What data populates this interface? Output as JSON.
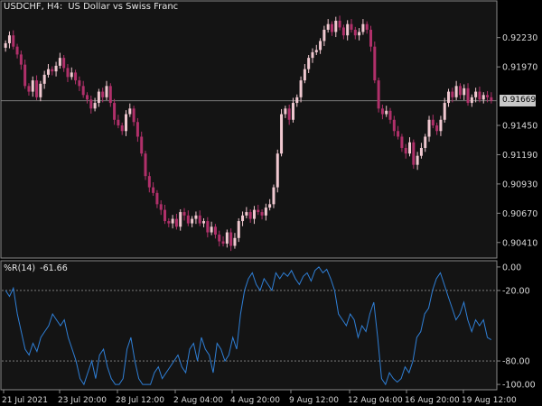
{
  "header": {
    "symbol": "USDCHF, H4:",
    "description": "US Dollar vs Swiss Franc"
  },
  "indicator": {
    "name": "%R(14)",
    "value": "-61.66"
  },
  "current_price": "0.91669",
  "colors": {
    "background": "#000000",
    "chart_bg": "#141414",
    "grid_border": "#8a8a8a",
    "bull_candle": "#f0c8d0",
    "bear_candle": "#b0306a",
    "indicator_line": "#2f7fd6",
    "level_line": "#8a8a8a"
  },
  "chart_data": [
    {
      "type": "candlestick",
      "title": "USDCHF, H4: US Dollar vs Swiss Franc",
      "y_ticks": [
        "0.92230",
        "0.91970",
        "0.91450",
        "0.91190",
        "0.90930",
        "0.90670",
        "0.90410"
      ],
      "ylim": [
        0.9032,
        0.925
      ],
      "x_ticks": [
        "21 Jul 2021",
        "23 Jul 20:00",
        "28 Jul 12:00",
        "2 Aug 04:00",
        "4 Aug 20:00",
        "9 Aug 12:00",
        "12 Aug 04:00",
        "16 Aug 20:00",
        "19 Aug 12:00"
      ],
      "current_price": 0.91669,
      "closes": [
        0.9218,
        0.9225,
        0.9215,
        0.9208,
        0.9199,
        0.918,
        0.9175,
        0.9185,
        0.917,
        0.9182,
        0.919,
        0.9195,
        0.9193,
        0.9198,
        0.9205,
        0.9196,
        0.9188,
        0.9192,
        0.9185,
        0.918,
        0.9172,
        0.9168,
        0.916,
        0.9165,
        0.9175,
        0.917,
        0.918,
        0.9165,
        0.915,
        0.9145,
        0.914,
        0.9155,
        0.916,
        0.9148,
        0.9135,
        0.912,
        0.91,
        0.909,
        0.9085,
        0.9075,
        0.907,
        0.906,
        0.9058,
        0.9062,
        0.9055,
        0.9068,
        0.9065,
        0.9058,
        0.9062,
        0.9065,
        0.9058,
        0.906,
        0.905,
        0.9055,
        0.9048,
        0.9042,
        0.904,
        0.905,
        0.9038,
        0.9045,
        0.906,
        0.9065,
        0.9068,
        0.9062,
        0.907,
        0.9068,
        0.9065,
        0.9072,
        0.9075,
        0.909,
        0.912,
        0.9155,
        0.916,
        0.915,
        0.9165,
        0.917,
        0.9185,
        0.9195,
        0.9205,
        0.921,
        0.9212,
        0.922,
        0.923,
        0.9235,
        0.9228,
        0.9238,
        0.9232,
        0.9225,
        0.9235,
        0.923,
        0.9225,
        0.9228,
        0.9235,
        0.923,
        0.9215,
        0.9185,
        0.916,
        0.9155,
        0.9158,
        0.915,
        0.914,
        0.9135,
        0.9125,
        0.912,
        0.913,
        0.911,
        0.9118,
        0.9125,
        0.9135,
        0.915,
        0.9145,
        0.914,
        0.915,
        0.9165,
        0.9175,
        0.917,
        0.918,
        0.9172,
        0.9178,
        0.9165,
        0.917,
        0.9175,
        0.9168,
        0.9172,
        0.917,
        0.9167
      ]
    },
    {
      "type": "line",
      "series": [
        {
          "name": "%R(14)",
          "values": [
            -20,
            -25,
            -18,
            -40,
            -55,
            -70,
            -75,
            -65,
            -72,
            -60,
            -55,
            -50,
            -40,
            -45,
            -50,
            -45,
            -60,
            -70,
            -80,
            -95,
            -100,
            -90,
            -80,
            -95,
            -75,
            -70,
            -85,
            -95,
            -100,
            -100,
            -95,
            -70,
            -60,
            -80,
            -95,
            -100,
            -100,
            -100,
            -90,
            -85,
            -95,
            -90,
            -85,
            -80,
            -75,
            -85,
            -90,
            -70,
            -65,
            -80,
            -60,
            -70,
            -75,
            -90,
            -65,
            -70,
            -80,
            -75,
            -60,
            -70,
            -40,
            -20,
            -10,
            -5,
            -15,
            -20,
            -10,
            -15,
            -20,
            -5,
            -10,
            -5,
            -8,
            -3,
            -10,
            -15,
            -8,
            -5,
            -12,
            -3,
            0,
            -5,
            -2,
            -10,
            -20,
            -40,
            -45,
            -50,
            -40,
            -45,
            -60,
            -50,
            -55,
            -40,
            -30,
            -60,
            -95,
            -100,
            -90,
            -95,
            -98,
            -95,
            -85,
            -90,
            -80,
            -60,
            -55,
            -40,
            -35,
            -20,
            -10,
            -5,
            -15,
            -25,
            -35,
            -45,
            -40,
            -30,
            -45,
            -55,
            -45,
            -50,
            -45,
            -60,
            -62
          ]
        }
      ],
      "y_ticks": [
        "0.00",
        "-20.00",
        "-80.00",
        "-100.00"
      ],
      "ylim": [
        -103,
        3
      ],
      "levels": [
        -20,
        -80
      ]
    }
  ]
}
